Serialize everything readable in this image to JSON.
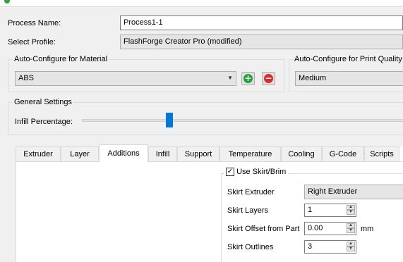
{
  "process": {
    "name_label": "Process Name:",
    "name_value": "Process1-1",
    "profile_label": "Select Profile:",
    "profile_value": "FlashForge Creator Pro (modified)"
  },
  "material": {
    "group_title": "Auto-Configure for Material",
    "selected": "ABS"
  },
  "quality": {
    "group_title": "Auto-Configure for Print Quality",
    "selected": "Medium"
  },
  "general": {
    "group_title": "General Settings",
    "infill_label": "Infill Percentage:",
    "infill_fraction": 0.27
  },
  "tabs": [
    {
      "label": "Extruder"
    },
    {
      "label": "Layer"
    },
    {
      "label": "Additions"
    },
    {
      "label": "Infill"
    },
    {
      "label": "Support"
    },
    {
      "label": "Temperature"
    },
    {
      "label": "Cooling"
    },
    {
      "label": "G-Code"
    },
    {
      "label": "Scripts"
    }
  ],
  "active_tab": "Additions",
  "skirt": {
    "checkbox_label": "Use Skirt/Brim",
    "checked": true,
    "extruder_label": "Skirt Extruder",
    "extruder_value": "Right Extruder",
    "layers_label": "Skirt Layers",
    "layers_value": "1",
    "offset_label": "Skirt Offset from Part",
    "offset_value": "0.00",
    "offset_unit": "mm",
    "outlines_label": "Skirt Outlines",
    "outlines_value": "3"
  }
}
